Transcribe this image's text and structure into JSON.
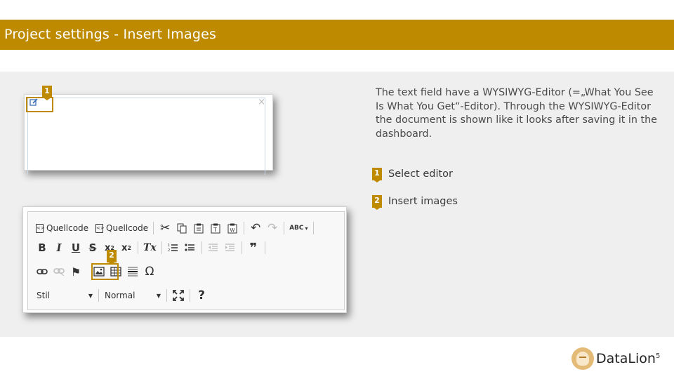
{
  "header": {
    "title": "Project settings - Insert Images"
  },
  "description": "The text field have a WYSIWYG-Editor (=„What You See Is What You Get“-Editor). Through the WYSIWYG-Editor the document is shown like it looks after saving it in the dashboard.",
  "steps": [
    {
      "number": "1",
      "label": "Select editor"
    },
    {
      "number": "2",
      "label": "Insert images"
    }
  ],
  "editor_field": {
    "edit_icon": "edit-icon",
    "close_label": "×"
  },
  "toolbar": {
    "source_label_1": "Quellcode",
    "source_label_2": "Quellcode",
    "cut": "✂",
    "undo": "↶",
    "redo": "↷",
    "spell": "ABC",
    "bold": "B",
    "italic": "I",
    "underline": "U",
    "strike": "S",
    "subscript": "x",
    "superscript": "x",
    "clear_format": "Tx",
    "blockquote": "❞",
    "flag": "⚑",
    "omega": "Ω",
    "style_combo": "Stil",
    "format_combo": "Normal",
    "help": "?"
  },
  "footer": {
    "brand": "DataLion",
    "page_number": "5"
  },
  "colors": {
    "accent": "#be8a00",
    "panel": "#efefef"
  }
}
